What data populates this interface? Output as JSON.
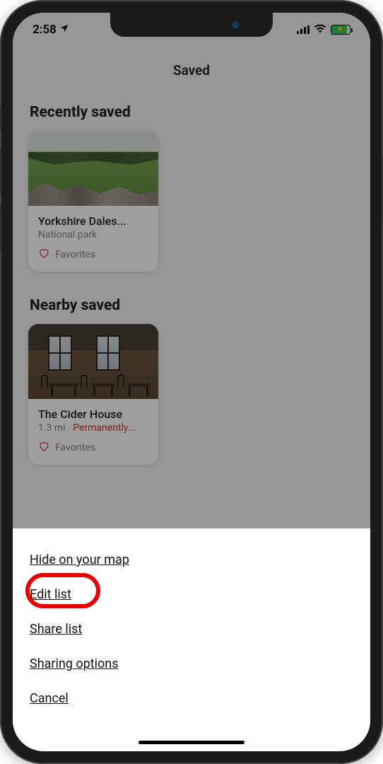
{
  "status": {
    "time": "2:58",
    "location_icon": "location-arrow-icon",
    "signal_icon": "cellular-signal-icon",
    "wifi_icon": "wifi-icon",
    "battery_icon": "battery-charging-icon"
  },
  "header": {
    "title": "Saved"
  },
  "sections": {
    "recent": {
      "header": "Recently saved",
      "card": {
        "title": "Yorkshire Dales...",
        "subtitle": "National park",
        "fav_label": "Favorites",
        "fav_icon": "heart-icon"
      }
    },
    "nearby": {
      "header": "Nearby saved",
      "card": {
        "title": "The Cider House",
        "distance": "1.3 mi",
        "separator": " · ",
        "status": "Permanently...",
        "fav_label": "Favorites",
        "fav_icon": "heart-icon"
      }
    }
  },
  "action_sheet": {
    "items": [
      "Hide on your map",
      "Edit list",
      "Share list",
      "Sharing options",
      "Cancel"
    ],
    "highlighted_index": 1
  },
  "colors": {
    "heart": "#d14660",
    "closed": "#c0392b",
    "highlight": "#e60000",
    "battery_fill": "#34c759"
  }
}
